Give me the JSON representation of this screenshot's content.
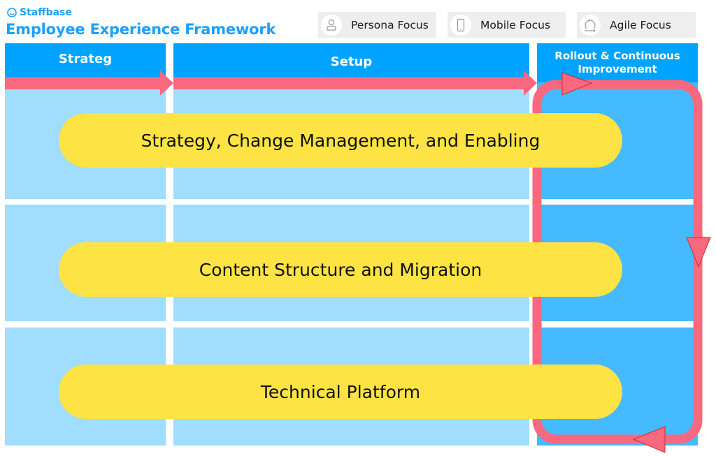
{
  "brand": {
    "name": "Staffbase",
    "icon": "staffbase-logo-icon"
  },
  "title": "Employee Experience Framework",
  "focus_buttons": [
    {
      "label": "Persona Focus",
      "icon": "person-icon"
    },
    {
      "label": "Mobile Focus",
      "icon": "mobile-phone-icon"
    },
    {
      "label": "Agile Focus",
      "icon": "cycle-arrows-icon"
    }
  ],
  "phases": [
    {
      "label": "Strateg"
    },
    {
      "label": "Setup"
    },
    {
      "label": "Rollout & Continuous Improvement"
    }
  ],
  "workstreams": [
    {
      "label": "Strategy, Change Management, and Enabling"
    },
    {
      "label": "Content Structure and Migration"
    },
    {
      "label": "Technical Platform"
    }
  ],
  "colors": {
    "brand_blue": "#1aa0ff",
    "header_blue": "#00a3ff",
    "cell_light_blue": "#a0ddff",
    "cell_dark_blue": "#45baff",
    "arrow_pink": "#f9687e",
    "pill_yellow": "#fde343"
  }
}
